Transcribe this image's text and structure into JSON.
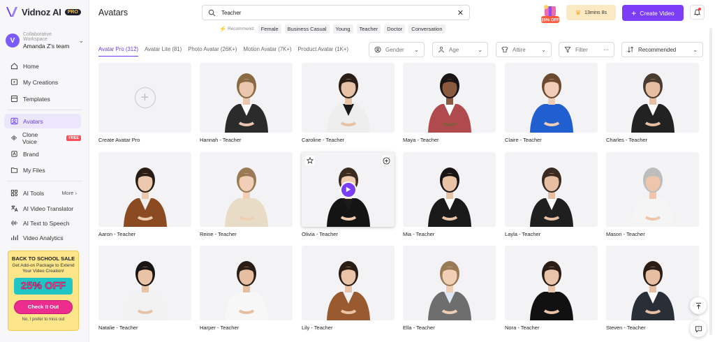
{
  "brand": {
    "name": "Vidnoz AI",
    "badge": "PRO"
  },
  "workspace": {
    "caption": "Collaborative Workspace",
    "name": "Amanda Z's team",
    "initial": "V"
  },
  "nav": {
    "home": "Home",
    "creations": "My Creations",
    "templates": "Templates",
    "avatars": "Avatars",
    "clone_voice": "Clone Voice",
    "clone_badge": "FREE",
    "brand": "Brand",
    "files": "My Files",
    "ai_tools": "AI Tools",
    "more": "More",
    "translator": "AI Video Translator",
    "tts": "AI Text to Speech",
    "analytics": "Video Analytics"
  },
  "promo": {
    "title": "BACK TO SCHOOL SALE",
    "subtitle": "Get Add-on Package to Extend Your Video Creation!",
    "discount": "25% OFF",
    "button": "Check It Out",
    "dismiss": "No, I prefer to miss out"
  },
  "header": {
    "title": "Avatars",
    "search_value": "Teacher",
    "sale_badge": "25% OFF",
    "timer": "13mins 8s",
    "create_label": "Create Video"
  },
  "recommend": {
    "label": "Recommend:",
    "chips": [
      "Female",
      "Business Casual",
      "Young",
      "Teacher",
      "Doctor",
      "Conversation"
    ]
  },
  "tabs": [
    "Avatar Pro (312)",
    "Avatar Lite (81)",
    "Photo Avatar (26K+)",
    "Motion Avatar (7K+)",
    "Product Avatar (1K+)"
  ],
  "filters": {
    "gender": "Gender",
    "age": "Age",
    "attire": "Attire",
    "filter": "Filter",
    "sort": "Recommended"
  },
  "avatars": [
    {
      "label": "Create Avatar Pro"
    },
    {
      "label": "Hannah - Teacher",
      "top": "#ffffff",
      "jacket": "#2b2b2b",
      "hair": "#8a6a45",
      "skin": "#e9c6ad"
    },
    {
      "label": "Caroline - Teacher",
      "top": "#1a1a1a",
      "jacket": "#eeeeee",
      "hair": "#2a1d16",
      "skin": "#e8c2a6"
    },
    {
      "label": "Maya - Teacher",
      "top": "#ffffff",
      "jacket": "#b04a4e",
      "hair": "#1a1414",
      "skin": "#8a5a40"
    },
    {
      "label": "Claire - Teacher",
      "top": "#1f5fd0",
      "jacket": "#1f5fd0",
      "hair": "#6b4a30",
      "skin": "#f0cdb6"
    },
    {
      "label": "Charles - Teacher",
      "top": "#ffffff",
      "jacket": "#222222",
      "hair": "#4a3b30",
      "skin": "#e6bfa3"
    },
    {
      "label": "Aaron - Teacher",
      "top": "#eeeeee",
      "jacket": "#8b4a22",
      "hair": "#2a1d16",
      "skin": "#ecc9ae"
    },
    {
      "label": "Reine - Teacher",
      "top": "#e9dcc6",
      "jacket": "#e9dcc6",
      "hair": "#9a7a55",
      "skin": "#f0cfb6"
    },
    {
      "label": "Olivia - Teacher",
      "top": "#1a1a1a",
      "jacket": "#141414",
      "hair": "#3a2a20",
      "skin": "#f0cbb0"
    },
    {
      "label": "Mia - Teacher",
      "top": "#ffffff",
      "jacket": "#1a1a1a",
      "hair": "#1a1414",
      "skin": "#e9c3a6"
    },
    {
      "label": "Layla - Teacher",
      "top": "#ffffff",
      "jacket": "#1f1f1f",
      "hair": "#3a2a20",
      "skin": "#e6bfa3"
    },
    {
      "label": "Mason - Teacher",
      "top": "#f5f5f5",
      "jacket": "#f5f5f5",
      "hair": "#bdbdbd",
      "skin": "#eec6ab"
    },
    {
      "label": "Natalie - Teacher",
      "top": "#f2f2f2",
      "jacket": "#f2f2f2",
      "hair": "#1a1414",
      "skin": "#e9c3a6"
    },
    {
      "label": "Harper - Teacher",
      "top": "#f7f7f7",
      "jacket": "#f7f7f7",
      "hair": "#2a1d16",
      "skin": "#e6bfa3"
    },
    {
      "label": "Lily - Teacher",
      "top": "#f2f2f2",
      "jacket": "#9a5a30",
      "hair": "#2a1d16",
      "skin": "#eac4a8"
    },
    {
      "label": "Ella - Teacher",
      "top": "#dfe9f5",
      "jacket": "#6e6e6e",
      "hair": "#9a7a55",
      "skin": "#f0cfb6"
    },
    {
      "label": "Nora - Teacher",
      "top": "#111111",
      "jacket": "#111111",
      "hair": "#2a1d16",
      "skin": "#eac4a8"
    },
    {
      "label": "Steven - Teacher",
      "top": "#ffffff",
      "jacket": "#2a2e36",
      "hair": "#2a1d16",
      "skin": "#e6bfa3"
    }
  ],
  "colors": {
    "accent": "#7b3df5",
    "active_bg": "#ebe6fb"
  }
}
